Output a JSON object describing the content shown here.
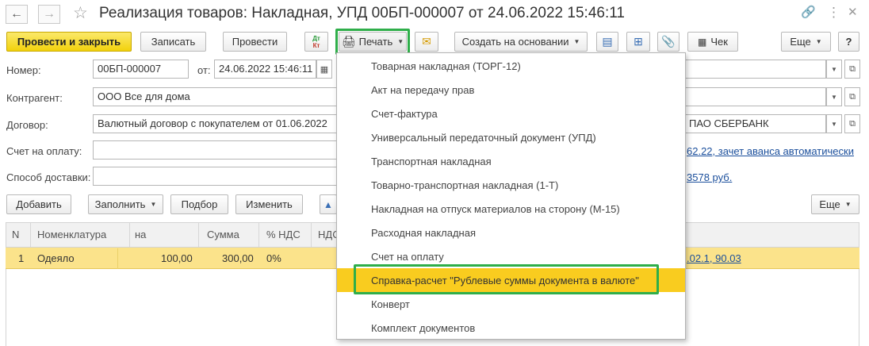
{
  "window": {
    "title": "Реализация товаров: Накладная, УПД 00БП-000007 от 24.06.2022 15:46:11"
  },
  "toolbar": {
    "post_close": "Провести и закрыть",
    "save": "Записать",
    "post": "Провести",
    "dtkt_top": "Дт",
    "dtkt_bottom": "Кт",
    "print": "Печать",
    "create_based": "Создать на основании",
    "check": "Чек",
    "more": "Еще",
    "help": "?"
  },
  "form": {
    "number_label": "Номер:",
    "number_value": "00БП-000007",
    "date_label": "от:",
    "date_value": "24.06.2022 15:46:11",
    "counterparty_label": "Контрагент:",
    "counterparty_value": "ООО Все для дома",
    "contract_label": "Договор:",
    "contract_value": "Валютный договор с покупателем от 01.06.2022",
    "contract_bank": "ПАО СБЕРБАНК",
    "invoice_label": "Счет на оплату:",
    "invoice_link": "62.22, зачет аванса автоматически",
    "delivery_label": "Способ доставки:",
    "amount_link": "3578 руб."
  },
  "table_toolbar": {
    "add": "Добавить",
    "fill": "Заполнить",
    "pick": "Подбор",
    "change": "Изменить",
    "more": "Еще"
  },
  "table": {
    "columns": [
      "N",
      "Номенклатура",
      "на",
      "Сумма",
      "% НДС",
      "НДС"
    ],
    "row": {
      "n": "1",
      "item": "Одеяло",
      "price": "100,00",
      "sum": "300,00",
      "vat_rate": "0%",
      "accounts": ".02.1, 90.03"
    }
  },
  "print_menu": {
    "items": [
      "Товарная накладная (ТОРГ-12)",
      "Акт на передачу прав",
      "Счет-фактура",
      "Универсальный передаточный документ (УПД)",
      "Транспортная накладная",
      "Товарно-транспортная накладная (1-Т)",
      "Накладная на отпуск материалов на сторону (М-15)",
      "Расходная накладная",
      "Счет на оплату",
      "Справка-расчет \"Рублевые суммы документа в валюте\"",
      "Конверт",
      "Комплект документов"
    ],
    "highlighted_index": 9
  },
  "colors": {
    "primary_button": "#f2d20c",
    "highlight": "#f9cc1f",
    "selected_row": "#fbe38b",
    "annotation_box": "#2fae4a",
    "link": "#1b4f9c"
  }
}
